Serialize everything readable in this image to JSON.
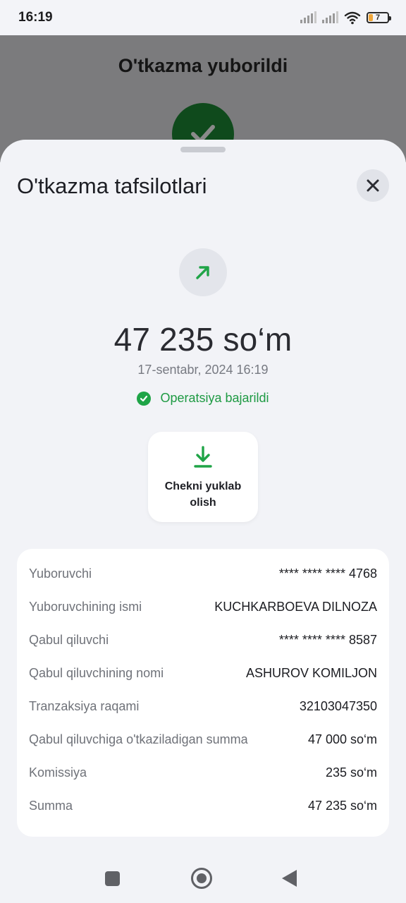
{
  "status_bar": {
    "time": "16:19",
    "battery_level": "7"
  },
  "background_page": {
    "title": "O'tkazma yuborildi"
  },
  "sheet": {
    "title": "O'tkazma tafsilotlari",
    "amount": "47 235 so‘m",
    "datetime": "17-sentabr, 2024 16:19",
    "status": "Operatsiya bajarildi",
    "download_label": "Chekni yuklab olish",
    "accent_color": "#1fa447",
    "details": [
      {
        "label": "Yuboruvchi",
        "value": "**** **** **** 4768"
      },
      {
        "label": "Yuboruvchining ismi",
        "value": "KUCHKARBOEVA DILNOZA"
      },
      {
        "label": "Qabul qiluvchi",
        "value": "**** **** **** 8587"
      },
      {
        "label": "Qabul qiluvchining nomi",
        "value": "ASHUROV KOMILJON"
      },
      {
        "label": "Tranzaksiya raqami",
        "value": "32103047350"
      },
      {
        "label": "Qabul qiluvchiga o'tkaziladigan summa",
        "value": "47 000 so‘m"
      },
      {
        "label": "Komissiya",
        "value": "235 so‘m"
      },
      {
        "label": "Summa",
        "value": "47 235 so‘m"
      }
    ]
  },
  "icons": {
    "close": "close-icon",
    "transfer": "arrow-up-right-icon",
    "success": "check-circle-icon",
    "download": "download-icon"
  }
}
